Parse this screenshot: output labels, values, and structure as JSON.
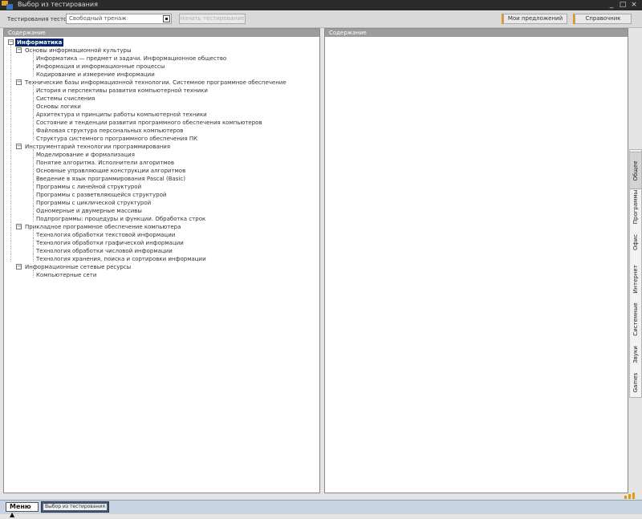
{
  "window": {
    "title": "Выбор из тестирования"
  },
  "toolbar": {
    "group_label": "Тестирования тестов",
    "select_value": "Свободный тренаж",
    "next_button": "Начать тестирование",
    "cfg_button": "Мои предложений",
    "help_button": "Справочник"
  },
  "left_panel": {
    "header": "Содержание"
  },
  "right_panel": {
    "header": "Содержание"
  },
  "tree": [
    {
      "label": "Информатика",
      "level": 0,
      "toggle": "−",
      "selected": true
    },
    {
      "label": "Основы информационной культуры",
      "level": 1,
      "toggle": "−"
    },
    {
      "label": "Информатика — предмет и задачи. Информационное общество",
      "level": 2
    },
    {
      "label": "Информация и информационные процессы",
      "level": 2
    },
    {
      "label": "Кодирование и измерение информации",
      "level": 2
    },
    {
      "label": "Технические базы информационной технологии. Системное программное обеспечение",
      "level": 1,
      "toggle": "−"
    },
    {
      "label": "История и перспективы развития компьютерной техники",
      "level": 2
    },
    {
      "label": "Системы счисления",
      "level": 2
    },
    {
      "label": "Основы логики",
      "level": 2
    },
    {
      "label": "Архитектура и принципы работы компьютерной техники",
      "level": 2
    },
    {
      "label": "Состояние и тенденции развития программного обеспечения компьютеров",
      "level": 2
    },
    {
      "label": "Файловая структура персональных компьютеров",
      "level": 2
    },
    {
      "label": "Структура системного программного обеспечения ПК",
      "level": 2
    },
    {
      "label": "Инструментарий технологии программирования",
      "level": 1,
      "toggle": "−"
    },
    {
      "label": "Моделирование и формализация",
      "level": 2
    },
    {
      "label": "Понятие алгоритма. Исполнители алгоритмов",
      "level": 2
    },
    {
      "label": "Основные управляющие конструкции алгоритмов",
      "level": 2
    },
    {
      "label": "Введение в язык программирования Pascal (Basic)",
      "level": 2
    },
    {
      "label": "Программы с линейной структурой",
      "level": 2
    },
    {
      "label": "Программы с разветвляющейся структурой",
      "level": 2
    },
    {
      "label": "Программы с циклической структурой",
      "level": 2
    },
    {
      "label": "Одномерные и двумерные массивы",
      "level": 2
    },
    {
      "label": "Подпрограммы: процедуры и функции. Обработка строк",
      "level": 2
    },
    {
      "label": "Прикладное программное обеспечение компьютера",
      "level": 1,
      "toggle": "−"
    },
    {
      "label": "Технология обработки текстовой информации",
      "level": 2
    },
    {
      "label": "Технология обработки графической информации",
      "level": 2
    },
    {
      "label": "Технология обработки числовой информации",
      "level": 2
    },
    {
      "label": "Технология хранения, поиска и сортировки информации",
      "level": 2
    },
    {
      "label": "Информационные сетевые ресурсы",
      "level": 1,
      "toggle": "−"
    },
    {
      "label": "Компьютерные сети",
      "level": 2
    }
  ],
  "side_tabs": [
    {
      "label": "Общее",
      "active": true
    },
    {
      "label": "Программы"
    },
    {
      "label": "Офис"
    },
    {
      "label": "Интернет"
    },
    {
      "label": "Системные"
    },
    {
      "label": "Звуки"
    },
    {
      "label": "Games"
    }
  ],
  "taskbar": {
    "menu_label": "Меню",
    "task_label": "Выбор из тестирования"
  }
}
